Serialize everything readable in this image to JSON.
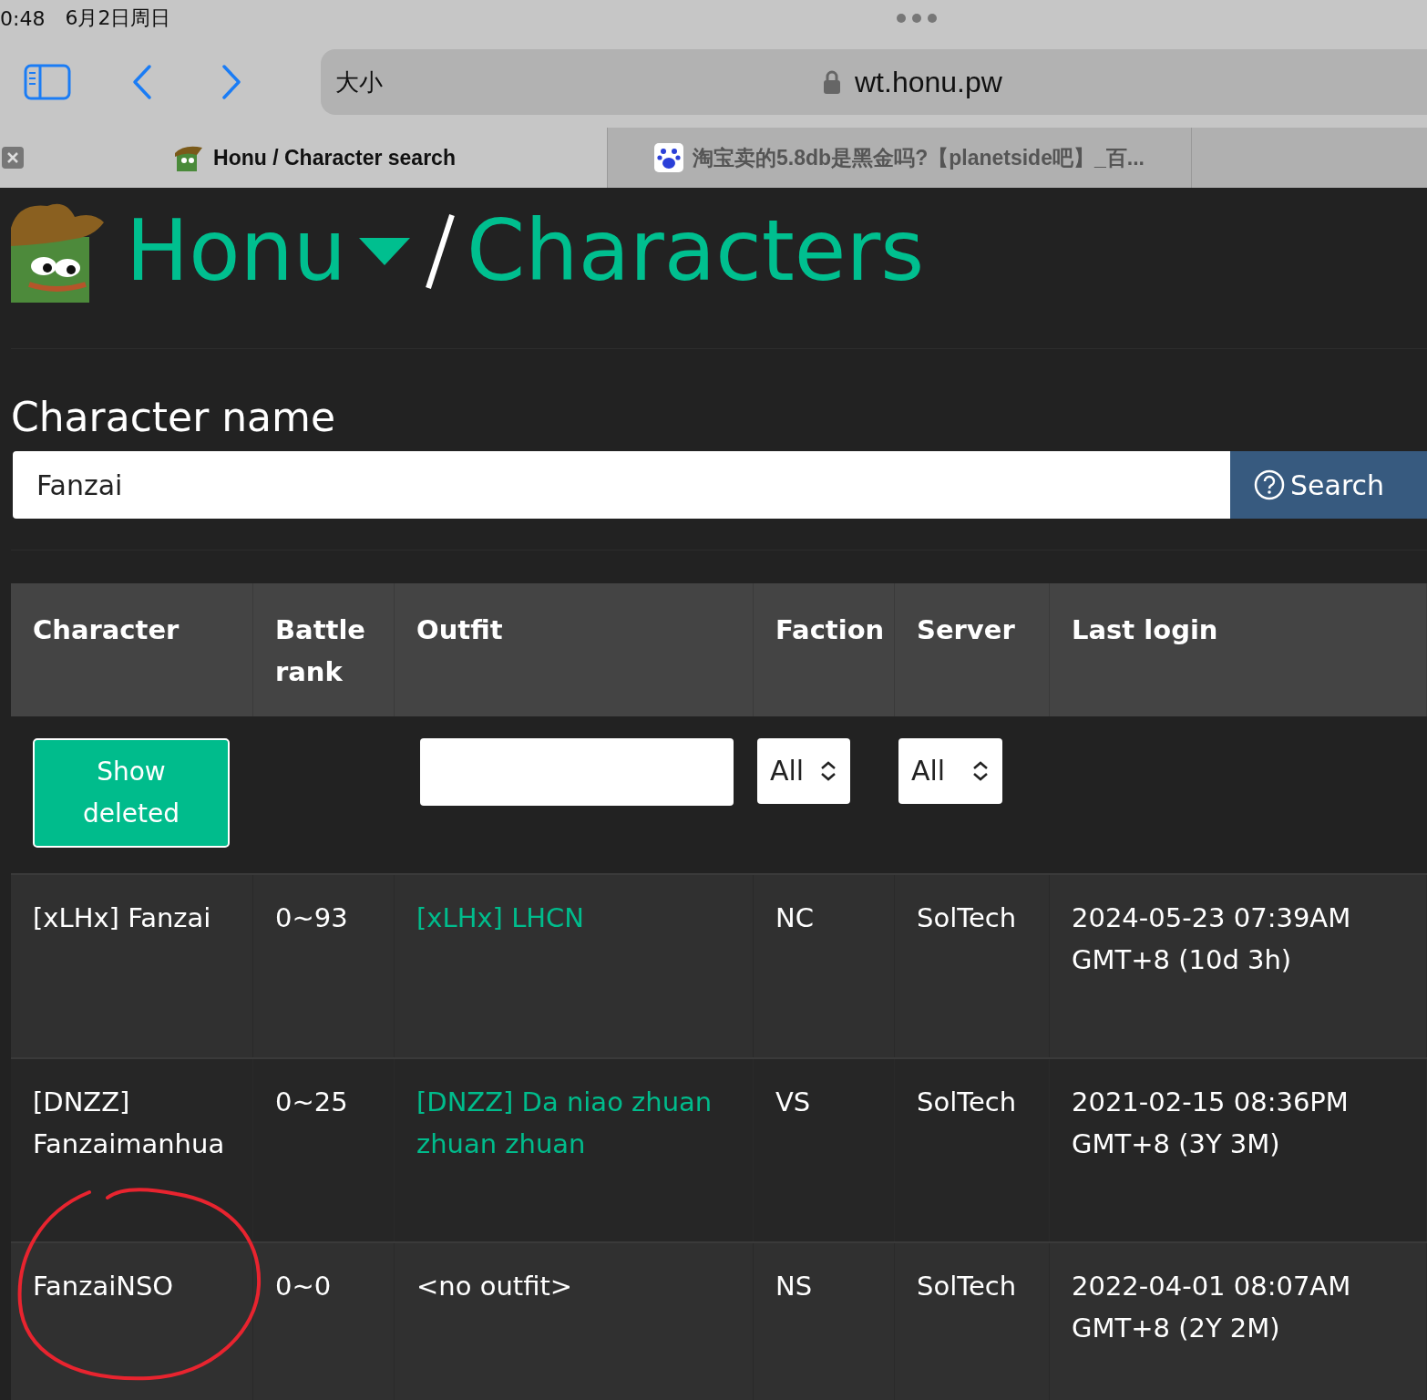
{
  "status_bar": {
    "time": "0:48",
    "date": "6月2日周日"
  },
  "toolbar": {
    "text_size": "大小",
    "url": "wt.honu.pw"
  },
  "tabs": [
    {
      "title": "Honu / Character search",
      "selected": true,
      "kind": "honu"
    },
    {
      "title": "淘宝卖的5.8db是黑金吗?【planetside吧】_百...",
      "selected": false,
      "kind": "baidu"
    }
  ],
  "header": {
    "site": "Honu",
    "page": "Characters"
  },
  "search": {
    "label": "Character name",
    "value": "Fanzai",
    "button": "Search"
  },
  "table": {
    "columns": [
      "Character",
      "Battle rank",
      "Outfit",
      "Faction",
      "Server",
      "Last login"
    ],
    "filters": {
      "show_deleted": "Show deleted",
      "faction": "All",
      "server": "All"
    },
    "rows": [
      {
        "character": "[xLHx] Fanzai",
        "battle_rank": "0~93",
        "outfit": "[xLHx] LHCN",
        "outfit_linked": true,
        "faction": "NC",
        "server": "SolTech",
        "last_login": "2024-05-23 07:39AM GMT+8 (10d 3h)",
        "circled": false
      },
      {
        "character": "[DNZZ] Fanzaimanhua",
        "battle_rank": "0~25",
        "outfit": "[DNZZ] Da niao zhuan zhuan zhuan",
        "outfit_linked": true,
        "faction": "VS",
        "server": "SolTech",
        "last_login": "2021-02-15 08:36PM GMT+8 (3Y 3M)",
        "circled": false
      },
      {
        "character": "FanzaiNSO",
        "battle_rank": "0~0",
        "outfit": "<no outfit>",
        "outfit_linked": false,
        "faction": "NS",
        "server": "SolTech",
        "last_login": "2022-04-01 08:07AM GMT+8 (2Y 2M)",
        "circled": true
      }
    ]
  }
}
